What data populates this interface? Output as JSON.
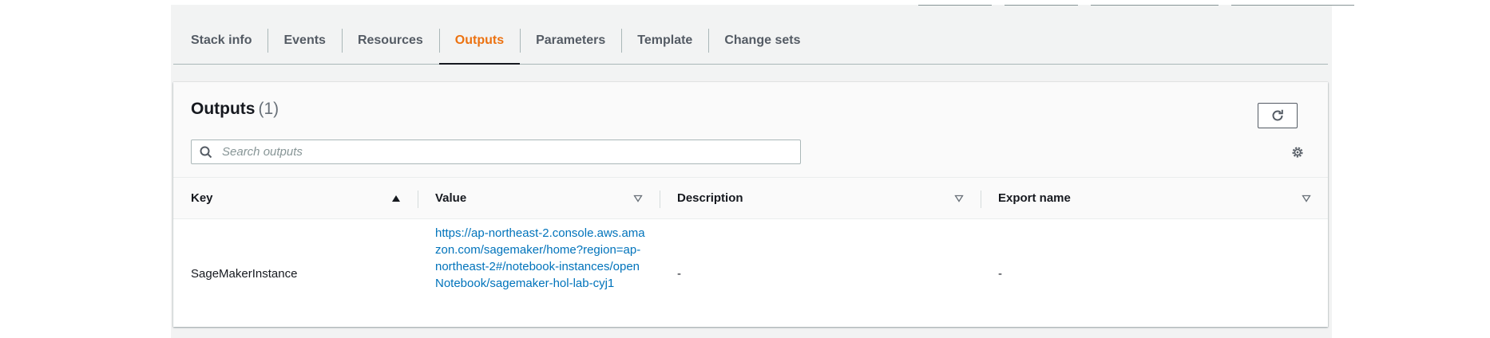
{
  "tabs": [
    {
      "label": "Stack info",
      "active": false
    },
    {
      "label": "Events",
      "active": false
    },
    {
      "label": "Resources",
      "active": false
    },
    {
      "label": "Outputs",
      "active": true
    },
    {
      "label": "Parameters",
      "active": false
    },
    {
      "label": "Template",
      "active": false
    },
    {
      "label": "Change sets",
      "active": false
    }
  ],
  "outputs_panel": {
    "title": "Outputs",
    "count": "(1)",
    "search_placeholder": "Search outputs",
    "refresh_icon": "refresh-icon",
    "settings_icon": "settings-gear-icon"
  },
  "table": {
    "columns": [
      {
        "label": "Key",
        "sort": "ascending"
      },
      {
        "label": "Value",
        "sort": "none"
      },
      {
        "label": "Description",
        "sort": "none"
      },
      {
        "label": "Export name",
        "sort": "none"
      }
    ],
    "rows": [
      {
        "key": "SageMakerInstance",
        "value": "https://ap-northeast-2.console.aws.amazon.com/sagemaker/home?region=ap-northeast-2#/notebook-instances/openNotebook/sagemaker-hol-lab-cyj1",
        "description": "-",
        "export_name": "-"
      }
    ]
  },
  "colors": {
    "active_tab": "#ec7211",
    "link": "#0073bb",
    "background": "#f2f3f3"
  }
}
